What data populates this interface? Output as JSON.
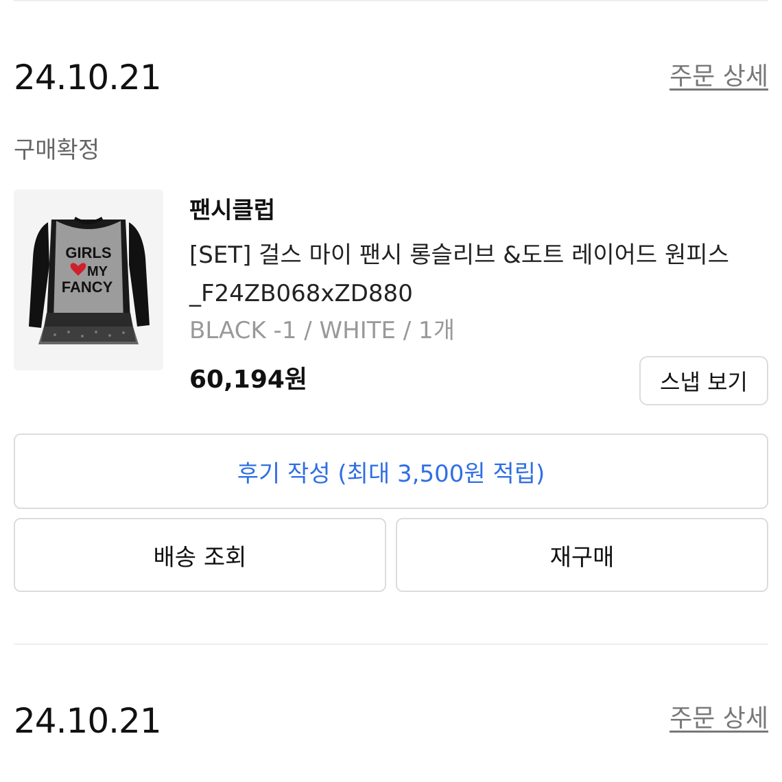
{
  "orders": [
    {
      "date": "24.10.21",
      "detail_link": "주문 상세",
      "status": "구매확정",
      "product": {
        "brand": "팬시클럽",
        "name": "[SET] 걸스 마이 팬시 롱슬리브 &도트 레이어드 원피스_F24ZB068xZD880",
        "option": "BLACK -1 / WHITE / 1개",
        "price": "60,194원",
        "image_text": [
          "GIRLS",
          "MY",
          "FANCY"
        ]
      },
      "snap_button": "스냅 보기",
      "review_button": "후기 작성 (최대 3,500원 적립)",
      "shipping_button": "배송 조회",
      "rebuy_button": "재구매"
    },
    {
      "date": "24.10.21",
      "detail_link": "주문 상세"
    }
  ],
  "colors": {
    "accent_link": "#2f6fe4",
    "muted_text": "#777777",
    "border": "#dcdcdc"
  }
}
